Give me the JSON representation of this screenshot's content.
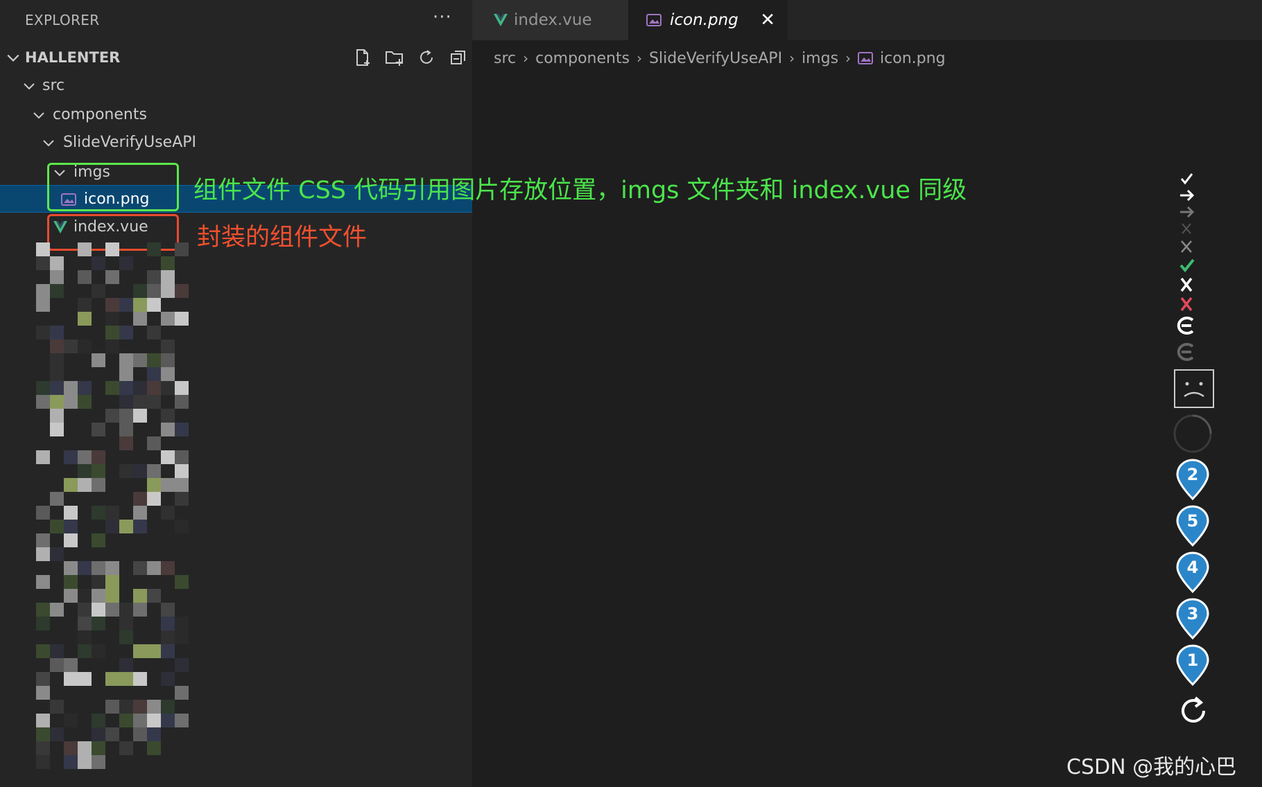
{
  "sidebar": {
    "title": "EXPLORER",
    "more_actions": "···",
    "project": "HALLENTER",
    "tree": [
      {
        "label": "src"
      },
      {
        "label": "components"
      },
      {
        "label": "SlideVerifyUseAPI"
      },
      {
        "label": "imgs"
      },
      {
        "label": "icon.png"
      },
      {
        "label": "index.vue"
      }
    ],
    "header_action_icons": [
      "new-file-icon",
      "new-folder-icon",
      "refresh-icon",
      "collapse-all-icon"
    ]
  },
  "tabs": [
    {
      "label": "index.vue",
      "icon": "vue-icon",
      "active": false
    },
    {
      "label": "icon.png",
      "icon": "image-file-icon",
      "active": true,
      "close": "✕"
    }
  ],
  "breadcrumb": [
    "src",
    "components",
    "SlideVerifyUseAPI",
    "imgs",
    "icon.png"
  ],
  "annotations": {
    "green": "组件文件 CSS 代码引用图片存放位置，imgs 文件夹和 index.vue 同级",
    "red": "封装的组件文件"
  },
  "preview_markers": [
    "2",
    "5",
    "4",
    "3",
    "1"
  ],
  "watermark": "CSDN @我的心巴",
  "colors": {
    "sidebar_bg": "#252526",
    "editor_bg": "#1e1e1e",
    "selection": "#094771",
    "vue_green": "#41b883",
    "annotation_green": "#4be44b",
    "annotation_red": "#f0502e",
    "marker_blue": "#2b86c9"
  }
}
